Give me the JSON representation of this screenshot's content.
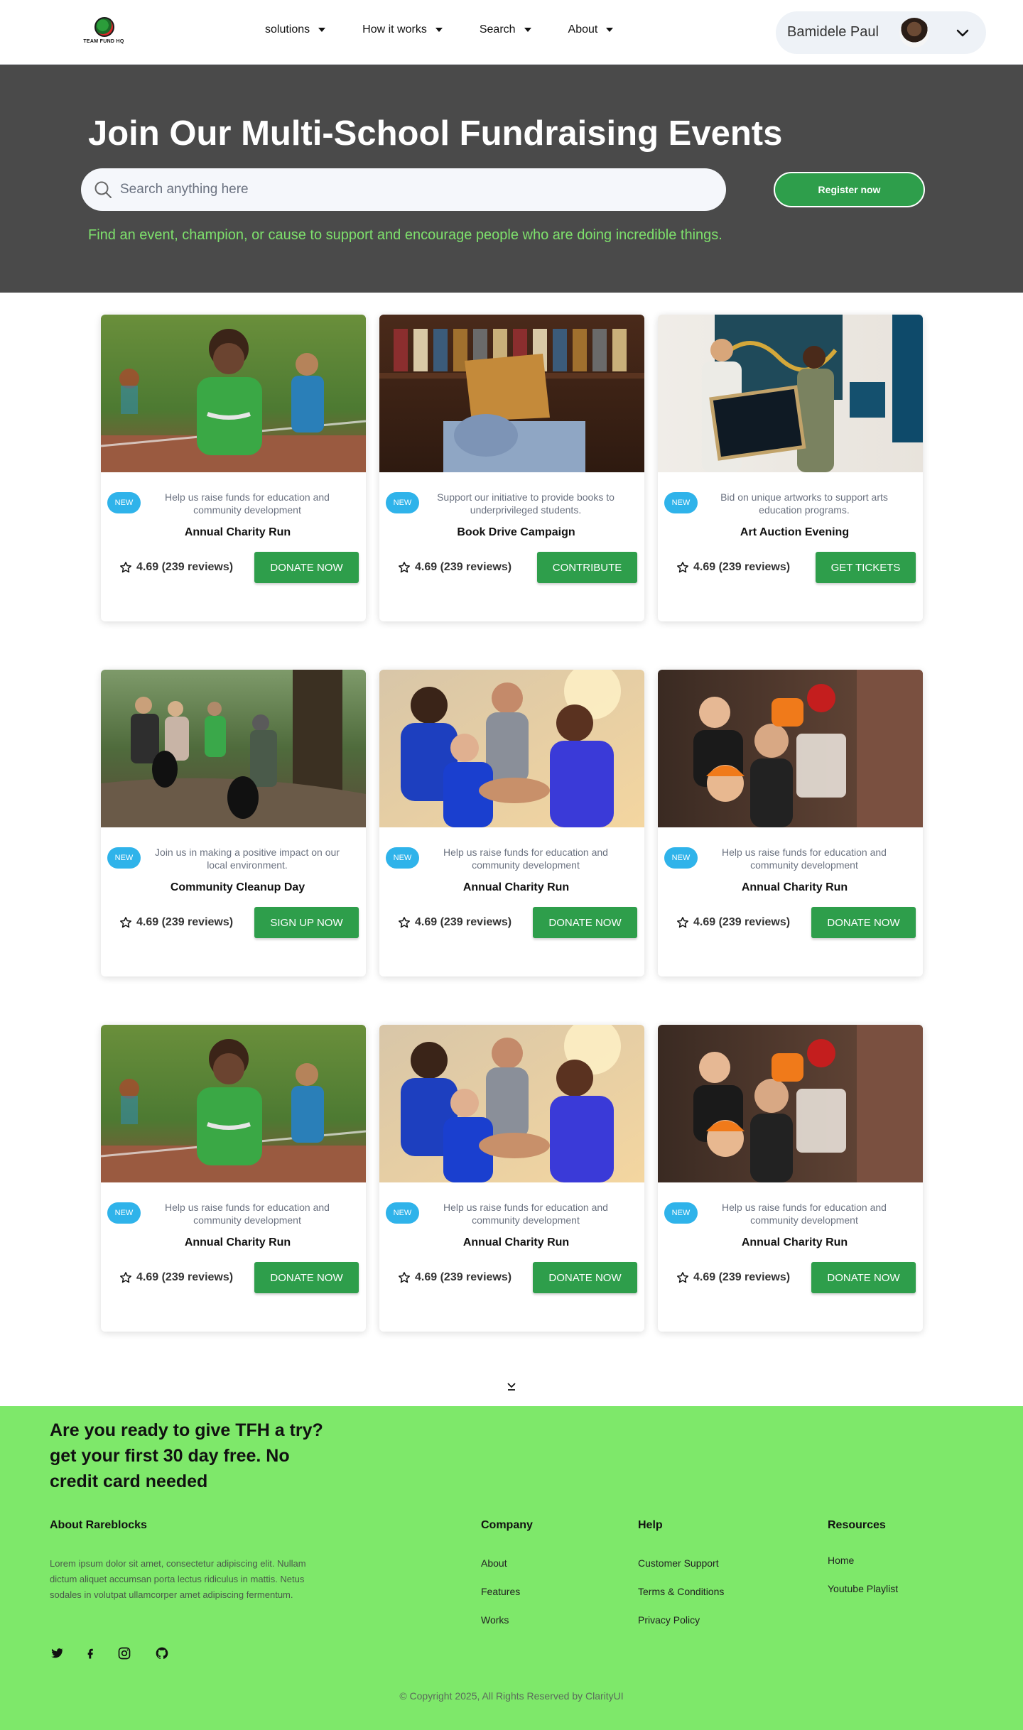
{
  "colors": {
    "accent": "#2e9e4b",
    "hero_bg": "#4a4a4a",
    "footer_bg": "#7ee86a",
    "badge": "#2fb3ea",
    "hero_sub": "#7ee06c"
  },
  "nav": {
    "logo_text": "TEAM FUND HQ",
    "links": [
      {
        "label": "solutions"
      },
      {
        "label": "How it works"
      },
      {
        "label": "Search"
      },
      {
        "label": "About"
      }
    ],
    "user_name": "Bamidele Paul"
  },
  "hero": {
    "title": "Join Our Multi-School Fundraising Events",
    "search_placeholder": "Search anything here",
    "register_label": "Register now",
    "subtitle": "Find an event, champion, or cause to support and encourage people who are doing incredible things."
  },
  "cards": [
    {
      "image": "running-child",
      "badge": "NEW",
      "desc": "Help us raise funds for education and community development",
      "title": "Annual Charity Run",
      "rating": "4.69 (239 reviews)",
      "button": "DONATE NOW"
    },
    {
      "image": "books-reader",
      "badge": "NEW",
      "desc": "Support our initiative to provide books to underprivileged students.",
      "title": "Book Drive Campaign",
      "rating": "4.69 (239 reviews)",
      "button": "CONTRIBUTE"
    },
    {
      "image": "art-gallery",
      "badge": "NEW",
      "desc": "Bid on unique artworks to support arts education programs.",
      "title": "Art Auction Evening",
      "rating": "4.69 (239 reviews)",
      "button": "GET TICKETS"
    },
    {
      "image": "cleanup-park",
      "badge": "NEW",
      "desc": "Join us in making a positive impact on our local environment.",
      "title": "Community Cleanup Day",
      "rating": "4.69 (239 reviews)",
      "button": "SIGN UP NOW"
    },
    {
      "image": "team-huddle",
      "badge": "NEW",
      "desc": "Help us raise funds for education and community development",
      "title": "Annual Charity Run",
      "rating": "4.69 (239 reviews)",
      "button": "DONATE NOW"
    },
    {
      "image": "kids-costumes",
      "badge": "NEW",
      "desc": "Help us raise funds for education and community development",
      "title": "Annual Charity Run",
      "rating": "4.69 (239 reviews)",
      "button": "DONATE NOW"
    },
    {
      "image": "running-child",
      "badge": "NEW",
      "desc": "Help us raise funds for education and community development",
      "title": "Annual Charity Run",
      "rating": "4.69 (239 reviews)",
      "button": "DONATE NOW"
    },
    {
      "image": "team-huddle",
      "badge": "NEW",
      "desc": "Help us raise funds for education and community development",
      "title": "Annual Charity Run",
      "rating": "4.69 (239 reviews)",
      "button": "DONATE NOW"
    },
    {
      "image": "kids-costumes",
      "badge": "NEW",
      "desc": "Help us raise funds for education and community development",
      "title": "Annual Charity Run",
      "rating": "4.69 (239 reviews)",
      "button": "DONATE NOW"
    }
  ],
  "footer": {
    "cta": "Are you ready to give TFH a try? get your first 30 day free. No credit card needed",
    "about_heading": "About Rareblocks",
    "about_text": "Lorem ipsum dolor sit amet, consectetur adipiscing elit. Nullam dictum aliquet accumsan porta lectus ridiculus in mattis. Netus sodales in volutpat ullamcorper amet adipiscing fermentum.",
    "company_heading": "Company",
    "company_links": [
      "About",
      "Features",
      "Works"
    ],
    "help_heading": "Help",
    "help_links": [
      "Customer Support",
      "Terms & Conditions",
      "Privacy Policy"
    ],
    "resources_heading": "Resources",
    "resources_links": [
      "Home",
      "Youtube Playlist"
    ],
    "social_icons": [
      "twitter-icon",
      "facebook-icon",
      "instagram-icon",
      "github-icon"
    ],
    "copyright": "© Copyright 2025, All Rights Reserved by ClarityUI"
  }
}
